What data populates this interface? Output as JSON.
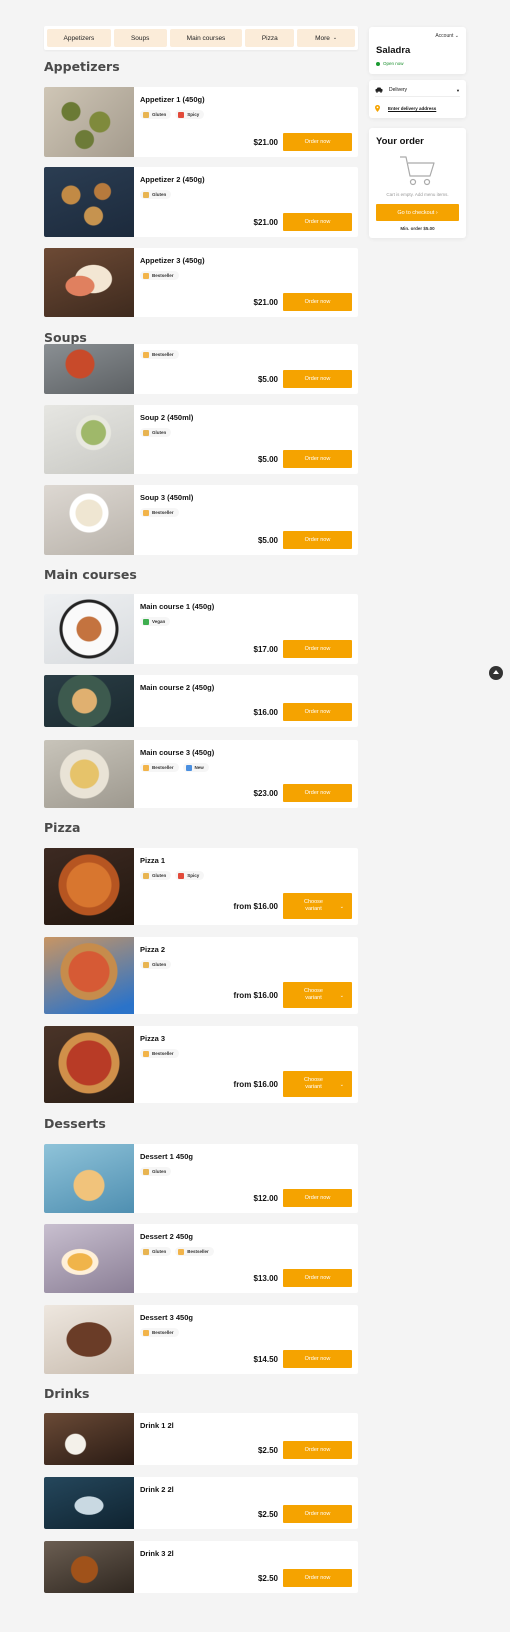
{
  "tabs": [
    "Appetizers",
    "Soups",
    "Main courses",
    "Pizza",
    "More"
  ],
  "sections": {
    "appetizers": "Appetizers",
    "soups": "Soups",
    "main": "Main courses",
    "pizza": "Pizza",
    "desserts": "Desserts",
    "drinks": "Drinks"
  },
  "items": [
    {
      "name": "Appetizer 1 (450g)",
      "tags": [
        "Gluten",
        "Spicy"
      ],
      "price": "$21.00",
      "button": "Order now"
    },
    {
      "name": "Appetizer 2 (450g)",
      "tags": [
        "Gluten"
      ],
      "price": "$21.00",
      "button": "Order now"
    },
    {
      "name": "Appetizer 3 (450g)",
      "tags": [
        "Bestseller"
      ],
      "price": "$21.00",
      "button": "Order now"
    },
    {
      "name": "",
      "tags": [
        "Bestseller"
      ],
      "price": "$5.00",
      "button": "Order now"
    },
    {
      "name": "Soup 2 (450ml)",
      "tags": [
        "Gluten"
      ],
      "price": "$5.00",
      "button": "Order now"
    },
    {
      "name": "Soup 3 (450ml)",
      "tags": [
        "Bestseller"
      ],
      "price": "$5.00",
      "button": "Order now"
    },
    {
      "name": "Main course 1 (450g)",
      "tags": [
        "Vegan"
      ],
      "price": "$17.00",
      "button": "Order now"
    },
    {
      "name": "Main course 2 (450g)",
      "tags": [],
      "price": "$16.00",
      "button": "Order now"
    },
    {
      "name": "Main course 3 (450g)",
      "tags": [
        "Bestseller",
        "New"
      ],
      "price": "$23.00",
      "button": "Order now"
    },
    {
      "name": "Pizza 1",
      "tags": [
        "Gluten",
        "Spicy"
      ],
      "price": "from $16.00",
      "button": "Choose variant"
    },
    {
      "name": "Pizza 2",
      "tags": [
        "Gluten"
      ],
      "price": "from $16.00",
      "button": "Choose variant"
    },
    {
      "name": "Pizza 3",
      "tags": [
        "Bestseller"
      ],
      "price": "from $16.00",
      "button": "Choose variant"
    },
    {
      "name": "Dessert 1 450g",
      "tags": [
        "Gluten"
      ],
      "price": "$12.00",
      "button": "Order now"
    },
    {
      "name": "Dessert 2 450g",
      "tags": [
        "Gluten",
        "Bestseller"
      ],
      "price": "$13.00",
      "button": "Order now"
    },
    {
      "name": "Dessert 3 450g",
      "tags": [
        "Bestseller"
      ],
      "price": "$14.50",
      "button": "Order now"
    },
    {
      "name": "Drink 1 2l",
      "tags": [],
      "price": "$2.50",
      "button": "Order now"
    },
    {
      "name": "Drink 2 2l",
      "tags": [],
      "price": "$2.50",
      "button": "Order now"
    },
    {
      "name": "Drink 3 2l",
      "tags": [],
      "price": "$2.50",
      "button": "Order now"
    }
  ],
  "sidebar": {
    "account": "Account",
    "shop_name": "Saladra",
    "status": "Open now",
    "delivery_mode": "Delivery",
    "address_link": "Enter delivery address",
    "order_title": "Your order",
    "empty_text": "Cart is empty. Add menu items.",
    "checkout": "Go to checkout",
    "min_order": "Min. order $5.00"
  },
  "colors": {
    "accent": "#f5a300",
    "tab_bg": "#fbecd9",
    "open": "#1a8f2d"
  }
}
